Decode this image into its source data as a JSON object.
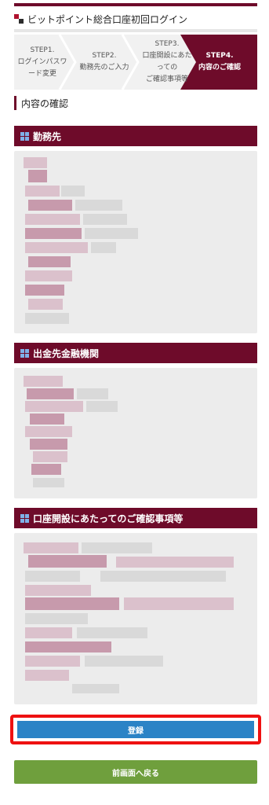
{
  "page": {
    "title": "ビットポイント総合口座初回ログイン"
  },
  "steps": [
    {
      "label": "STEP1.\nログインパスワ\nード変更",
      "active": false
    },
    {
      "label": "STEP2.\n勤務先のご入力",
      "active": false
    },
    {
      "label": "STEP3.\n口座開設にあた\nっての\nご確認事項等",
      "active": false
    },
    {
      "label": "STEP4.\n内容のご確認",
      "active": true
    }
  ],
  "section": {
    "heading": "内容の確認"
  },
  "groups": {
    "employer": {
      "title": "勤務先"
    },
    "bank": {
      "title": "出金先金融機関"
    },
    "confirm": {
      "title": "口座開設にあたってのご確認事項等"
    }
  },
  "buttons": {
    "register": "登録",
    "back": "前画面へ戻る"
  },
  "colors": {
    "brand": "#6e0b2a",
    "register": "#2b83c6",
    "back": "#6f9f3d",
    "highlight": "#ee1111"
  }
}
